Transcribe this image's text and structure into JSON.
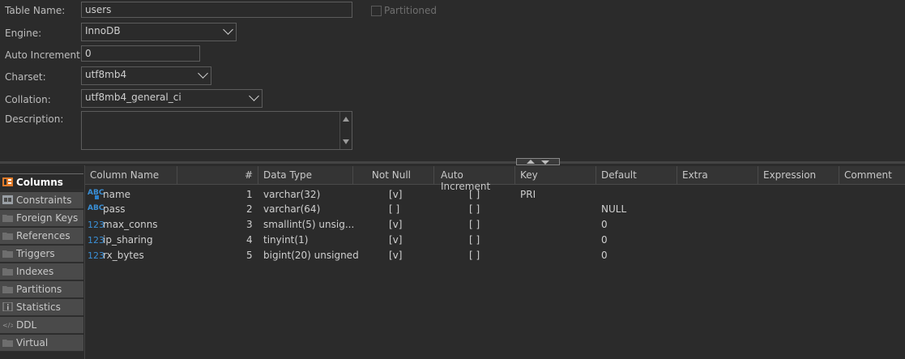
{
  "form": {
    "table_name_label": "Table Name:",
    "table_name_value": "users",
    "partitioned_label": "Partitioned",
    "engine_label": "Engine:",
    "engine_value": "InnoDB",
    "auto_increment_label": "Auto Increment:",
    "auto_increment_value": "0",
    "charset_label": "Charset:",
    "charset_value": "utf8mb4",
    "collation_label": "Collation:",
    "collation_value": "utf8mb4_general_ci",
    "description_label": "Description:",
    "description_value": ""
  },
  "sidebar": {
    "tabs": [
      {
        "label": "Columns",
        "icon": "columns-icon",
        "active": true
      },
      {
        "label": "Constraints",
        "icon": "constraints-icon"
      },
      {
        "label": "Foreign Keys",
        "icon": "folder-icon"
      },
      {
        "label": "References",
        "icon": "folder-icon"
      },
      {
        "label": "Triggers",
        "icon": "folder-icon"
      },
      {
        "label": "Indexes",
        "icon": "folder-icon"
      },
      {
        "label": "Partitions",
        "icon": "folder-icon"
      },
      {
        "label": "Statistics",
        "icon": "info-icon"
      },
      {
        "label": "DDL",
        "icon": "ddl-icon"
      },
      {
        "label": "Virtual",
        "icon": "folder-icon"
      }
    ]
  },
  "grid": {
    "headers": [
      "Column Name",
      "#",
      "Data Type",
      "Not Null",
      "Auto Increment",
      "Key",
      "Default",
      "Extra",
      "Expression",
      "Comment"
    ],
    "rows": [
      {
        "type_icon": "ABC",
        "name": "name",
        "pos": "1",
        "data_type": "varchar(32)",
        "not_null": "[v]",
        "auto_inc": "[ ]",
        "key": "PRI",
        "default": "",
        "is_key": true
      },
      {
        "type_icon": "ABC",
        "name": "pass",
        "pos": "2",
        "data_type": "varchar(64)",
        "not_null": "[ ]",
        "auto_inc": "[ ]",
        "key": "",
        "default": "NULL"
      },
      {
        "type_icon": "123",
        "name": "max_conns",
        "pos": "3",
        "data_type": "smallint(5) unsig...",
        "not_null": "[v]",
        "auto_inc": "[ ]",
        "key": "",
        "default": "0"
      },
      {
        "type_icon": "123",
        "name": "ip_sharing",
        "pos": "4",
        "data_type": "tinyint(1)",
        "not_null": "[v]",
        "auto_inc": "[ ]",
        "key": "",
        "default": "0"
      },
      {
        "type_icon": "123",
        "name": "rx_bytes",
        "pos": "5",
        "data_type": "bigint(20) unsigned",
        "not_null": "[v]",
        "auto_inc": "[ ]",
        "key": "",
        "default": "0"
      }
    ]
  },
  "colors": {
    "accent": "#2a7fc9",
    "background": "#2b2b2b",
    "tab_inactive": "#4a4a4a"
  }
}
